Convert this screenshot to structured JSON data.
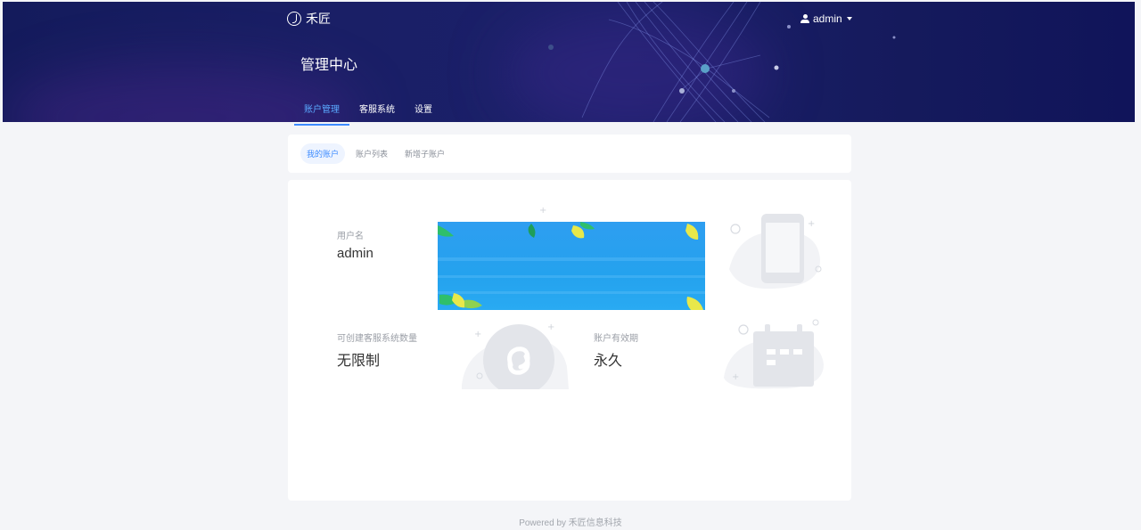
{
  "brand": {
    "name": "禾匠"
  },
  "user_menu": {
    "username": "admin"
  },
  "page_title": "管理中心",
  "main_tabs": [
    {
      "label": "账户管理",
      "active": true
    },
    {
      "label": "客服系统",
      "active": false
    },
    {
      "label": "设置",
      "active": false
    }
  ],
  "sub_tabs": [
    {
      "label": "我的账户",
      "active": true
    },
    {
      "label": "账户列表",
      "active": false
    },
    {
      "label": "新增子账户",
      "active": false
    }
  ],
  "account": {
    "username_label": "用户名",
    "username_value": "admin",
    "quota_label": "可创建客服系统数量",
    "quota_value": "无限制",
    "validity_label": "账户有效期",
    "validity_value": "永久"
  },
  "footer": {
    "text": "Powered by 禾匠信息科技"
  },
  "colors": {
    "header_bg": "#1a1f66",
    "accent": "#3d8bff",
    "page_bg": "#f4f5f8",
    "banner_blue": "#24a2ee"
  }
}
